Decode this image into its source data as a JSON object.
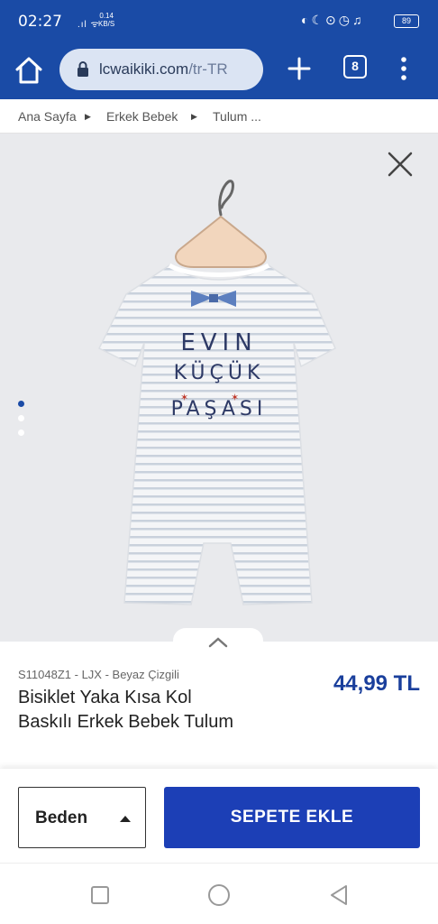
{
  "status_bar": {
    "time": "02:27",
    "net_speed_value": "0.14",
    "net_speed_unit": "KB/S",
    "battery": "89"
  },
  "browser": {
    "url_host": "lcwaikiki.com",
    "url_path": "/tr-TR",
    "tab_count": "8"
  },
  "breadcrumb": {
    "items": [
      "Ana Sayfa",
      "Erkek Bebek",
      "Tulum ..."
    ]
  },
  "gallery": {
    "print_text": [
      "EVIN",
      "KÜÇÜK",
      "PAŞASI"
    ],
    "active_slide": 1,
    "slide_count": 3
  },
  "product": {
    "sku": "S11048Z1 - LJX - Beyaz Çizgili",
    "title": "Bisiklet Yaka Kısa Kol Baskılı Erkek Bebek Tulum",
    "price": "44,99 TL"
  },
  "actions": {
    "size_label": "Beden",
    "add_to_cart_label": "SEPETE EKLE"
  },
  "colors": {
    "brand_blue": "#1a4ba6",
    "button_blue": "#1c3fb6",
    "price_blue": "#1a3f9c"
  }
}
